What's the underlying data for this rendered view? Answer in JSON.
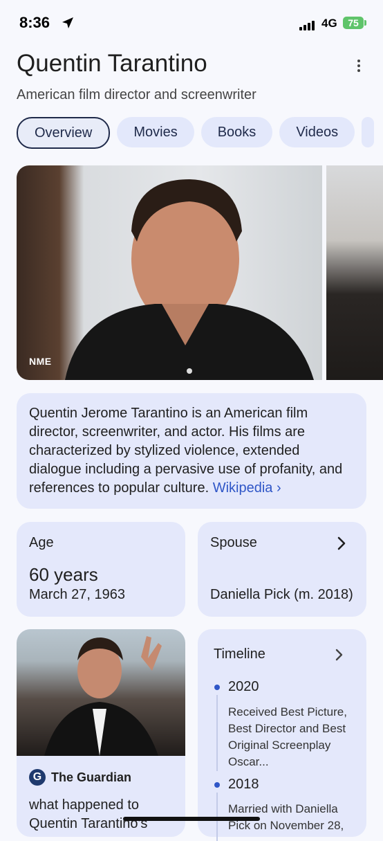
{
  "status_bar": {
    "time": "8:36",
    "network": "4G",
    "battery": "75"
  },
  "header": {
    "title": "Quentin Tarantino",
    "subtitle": "American film director and screenwriter"
  },
  "tabs": [
    {
      "label": "Overview",
      "active": true
    },
    {
      "label": "Movies",
      "active": false
    },
    {
      "label": "Books",
      "active": false
    },
    {
      "label": "Videos",
      "active": false
    }
  ],
  "images": {
    "main_source": "NME"
  },
  "description": {
    "text": "Quentin Jerome Tarantino is an American film director, screenwriter, and actor. His films are characterized by stylized violence, extended dialogue including a pervasive use of profanity, and references to popular culture.",
    "link_label": "Wikipedia ›"
  },
  "age": {
    "label": "Age",
    "value": "60 years",
    "birth_date": "March 27, 1963"
  },
  "spouse": {
    "label": "Spouse",
    "value": "Daniella Pick (m. 2018)"
  },
  "news": {
    "source": "The Guardian",
    "headline": "what happened to Quentin Tarantino's"
  },
  "timeline": {
    "label": "Timeline",
    "entries": [
      {
        "year": "2020",
        "text": "Received Best Picture, Best Director and Best Original Screenplay Oscar..."
      },
      {
        "year": "2018",
        "text": "Married with Daniella Pick on November 28,"
      }
    ]
  },
  "colors": {
    "card_bg": "#e4e8fb",
    "accent": "#2f56c7",
    "battery": "#5fc46a"
  },
  "icons": [
    "location-arrow-icon",
    "signal-icon",
    "battery-icon",
    "more-vert-icon",
    "chevron-right-icon",
    "guardian-logo-icon"
  ]
}
